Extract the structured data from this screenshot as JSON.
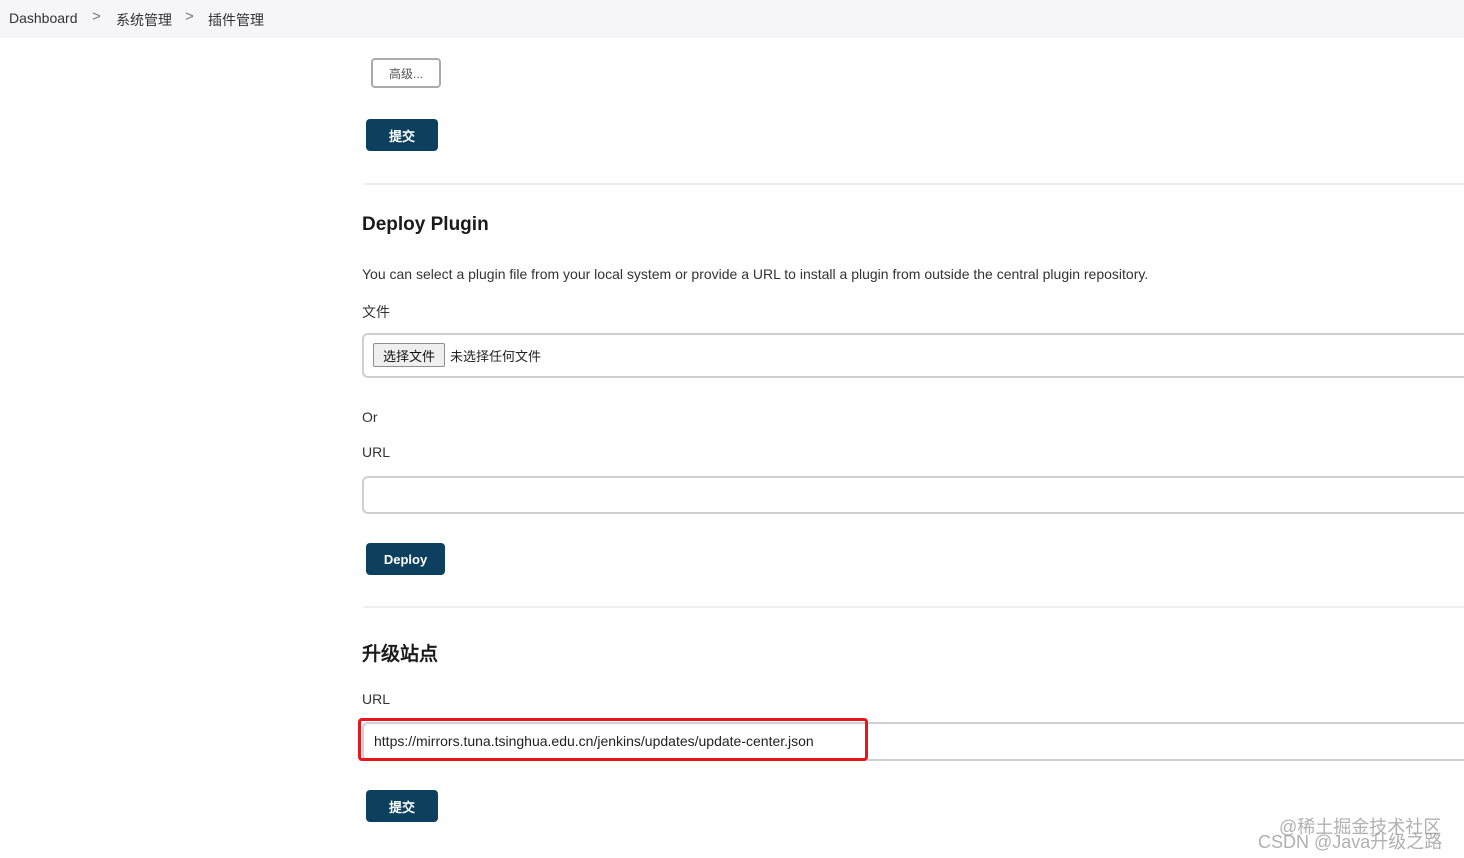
{
  "breadcrumb": {
    "items": [
      "Dashboard",
      "系统管理",
      "插件管理"
    ],
    "separator": ">"
  },
  "top_section": {
    "advanced_button": "高级...",
    "submit_button": "提交"
  },
  "deploy_plugin": {
    "title": "Deploy Plugin",
    "description": "You can select a plugin file from your local system or provide a URL to install a plugin from outside the central plugin repository.",
    "file_label": "文件",
    "choose_file_button": "选择文件",
    "no_file_text": "未选择任何文件",
    "or_text": "Or",
    "url_label": "URL",
    "url_value": "",
    "deploy_button": "Deploy"
  },
  "update_site": {
    "title": "升级站点",
    "url_label": "URL",
    "url_value": "https://mirrors.tuna.tsinghua.edu.cn/jenkins/updates/update-center.json",
    "submit_button": "提交"
  },
  "watermark": {
    "line1": "@稀土掘金技术社区",
    "line2": "CSDN @Java升级之路"
  },
  "colors": {
    "primary_button": "#0d405e",
    "highlight": "#e8151b",
    "breadcrumb_bg": "#f6f6f8"
  }
}
